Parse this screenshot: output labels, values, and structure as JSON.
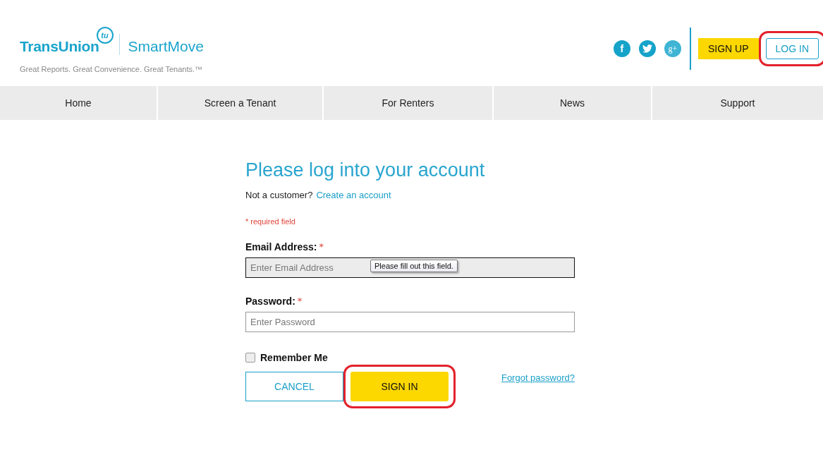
{
  "header": {
    "brand": "TransUnion",
    "brand_badge": "tu",
    "product": "SmartMove",
    "tagline": "Great Reports. Great Convenience. Great Tenants.™",
    "social": [
      {
        "kind": "facebook",
        "glyph": "f"
      },
      {
        "kind": "twitter"
      },
      {
        "kind": "google",
        "glyph": "g+"
      }
    ],
    "buttons": [
      {
        "kind": "filled",
        "label": "SIGN UP",
        "highlighted": false
      },
      {
        "kind": "outline",
        "label": "LOG IN",
        "highlighted": true
      }
    ]
  },
  "nav": [
    {
      "label": "Home"
    },
    {
      "label": "Screen a Tenant"
    },
    {
      "label": "For Renters"
    },
    {
      "label": "News"
    },
    {
      "label": "Support"
    }
  ],
  "form": {
    "title": "Please log into your account",
    "prompt": "Not a customer?",
    "create_link": "Create an account",
    "required_note": "* required field",
    "fields": [
      {
        "label": "Email Address:",
        "required": "*",
        "placeholder": "Enter Email Address",
        "focused": true,
        "tooltip": "Please fill out this field."
      },
      {
        "label": "Password:",
        "required": "*",
        "placeholder": "Enter Password",
        "focused": false
      }
    ],
    "remember": {
      "label": "Remember Me",
      "checked": false
    },
    "buttons": [
      {
        "kind": "outline",
        "label": "CANCEL",
        "highlighted": false
      },
      {
        "kind": "filled",
        "label": "SIGN IN",
        "highlighted": true
      }
    ],
    "forgot_link": "Forgot password?"
  }
}
